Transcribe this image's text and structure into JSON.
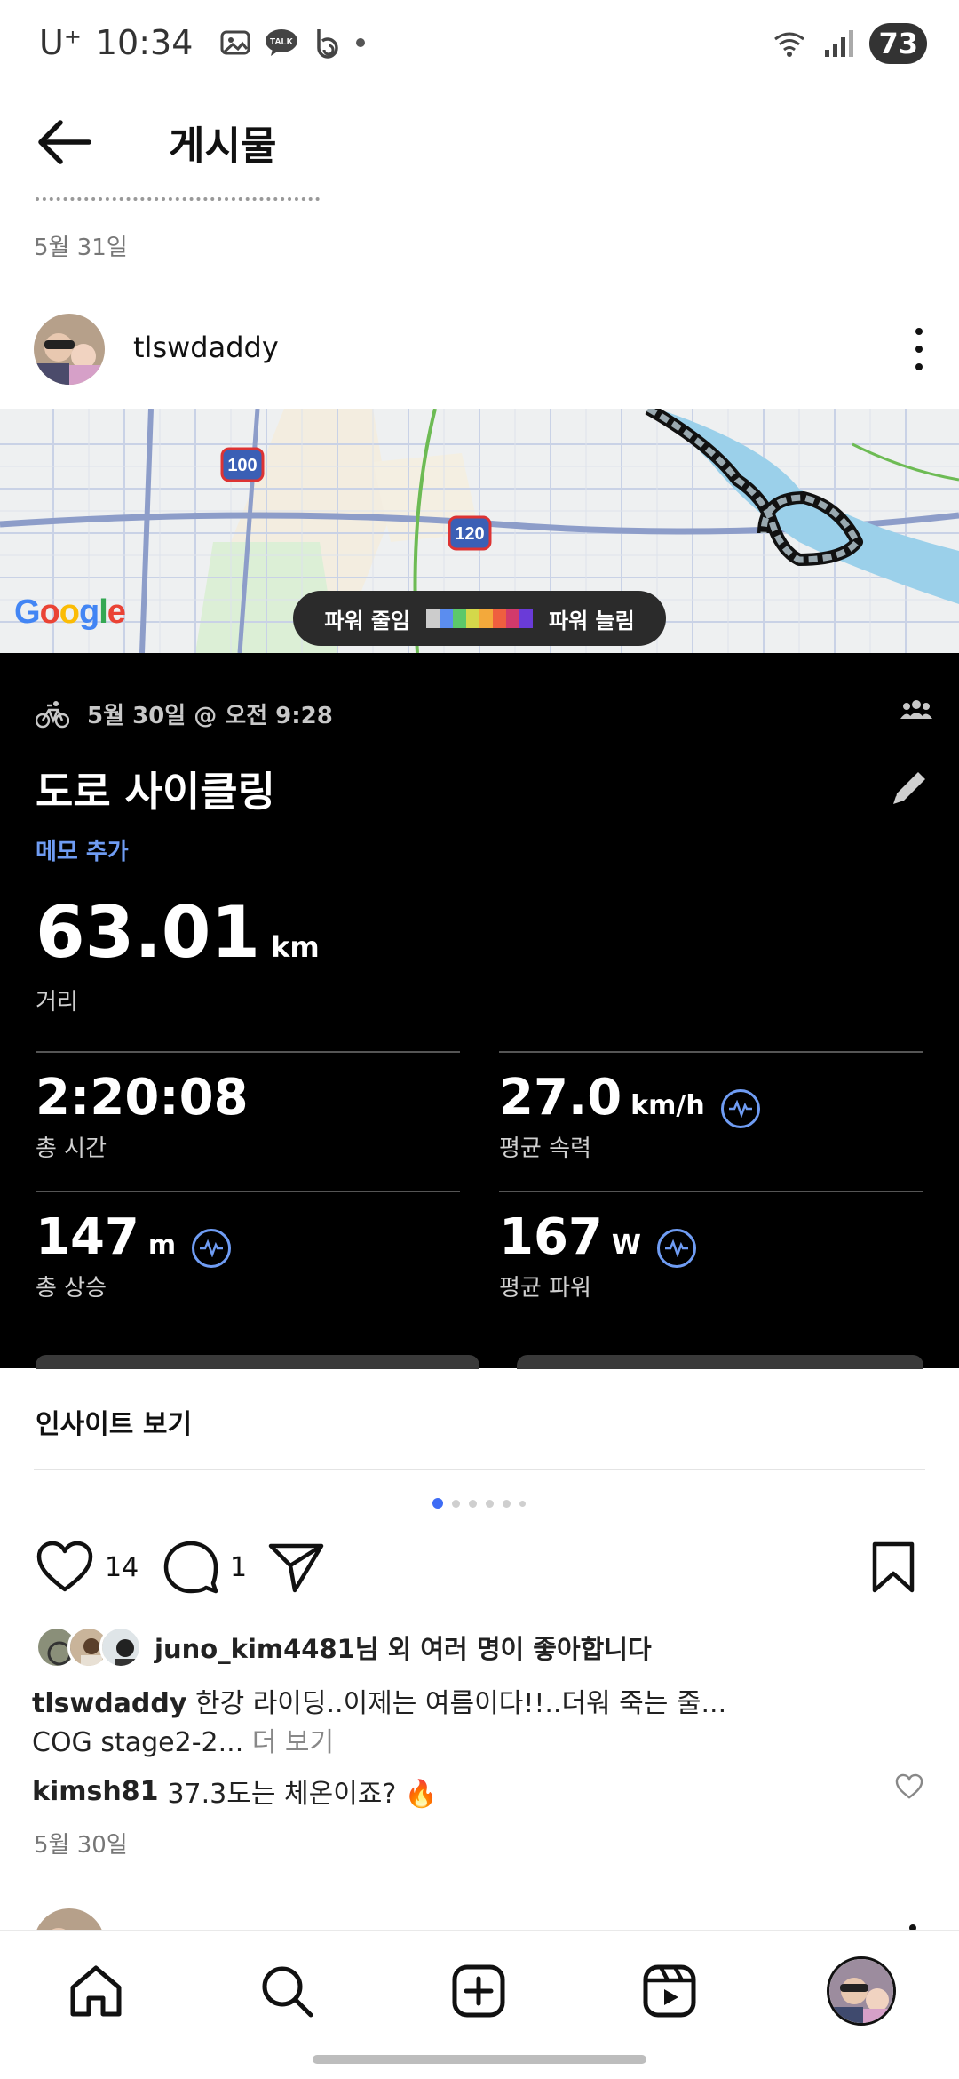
{
  "status_bar": {
    "carrier": "U⁺",
    "time": "10:34",
    "battery": "73",
    "icons": [
      "gallery-notification-icon",
      "kakaotalk-icon",
      "b-app-icon",
      "dot-icon",
      "wifi-icon",
      "signal-icon"
    ]
  },
  "header": {
    "title": "게시물"
  },
  "previous_post": {
    "date": "5월 31일"
  },
  "post": {
    "username": "tlswdaddy",
    "map": {
      "highway_labels": [
        "100",
        "120"
      ],
      "google_logo": "Google",
      "legend_low": "파워 줄임",
      "legend_high": "파워 늘림",
      "legend_colors": [
        "#cccccc",
        "#5b8def",
        "#5cc86a",
        "#d4d84a",
        "#f3a93b",
        "#ef5f3f",
        "#d23a6b",
        "#6a3bd8"
      ]
    },
    "activity": {
      "datetime": "5월 30일 @ 오전 9:28",
      "title": "도로 사이클링",
      "add_memo": "메모 추가",
      "distance_value": "63.01",
      "distance_unit": "km",
      "distance_label": "거리",
      "stats": [
        {
          "value": "2:20:08",
          "unit": "",
          "label": "총 시간",
          "insight": false
        },
        {
          "value": "27.0",
          "unit": "km/h",
          "label": "평균 속력",
          "insight": true
        },
        {
          "value": "147",
          "unit": "m",
          "label": "총 상승",
          "insight": true
        },
        {
          "value": "167",
          "unit": "W",
          "label": "평균 파워",
          "insight": true
        }
      ]
    },
    "insights_label": "인사이트 보기",
    "carousel": {
      "total": 6,
      "active": 0
    },
    "likes_count": "14",
    "comments_count": "1",
    "liked_by": "juno_kim4481님 외 여러 명이 좋아합니다",
    "caption_user": "tlswdaddy",
    "caption_text": "한강 라이딩..이제는 여름이다!!..더워 죽는 줄...",
    "caption_line2": "COG stage2-2...",
    "more_label": "더 보기",
    "comment_user": "kimsh81",
    "comment_text": "37.3도는 체온이죠? 🔥",
    "date": "5월 30일"
  },
  "colors": {
    "accent_blue": "#6f9cf3",
    "carousel_active": "#3e6cf5",
    "card_bg": "#000000"
  },
  "bottom_nav": [
    "home-icon",
    "search-icon",
    "create-icon",
    "reels-icon",
    "profile-avatar"
  ]
}
